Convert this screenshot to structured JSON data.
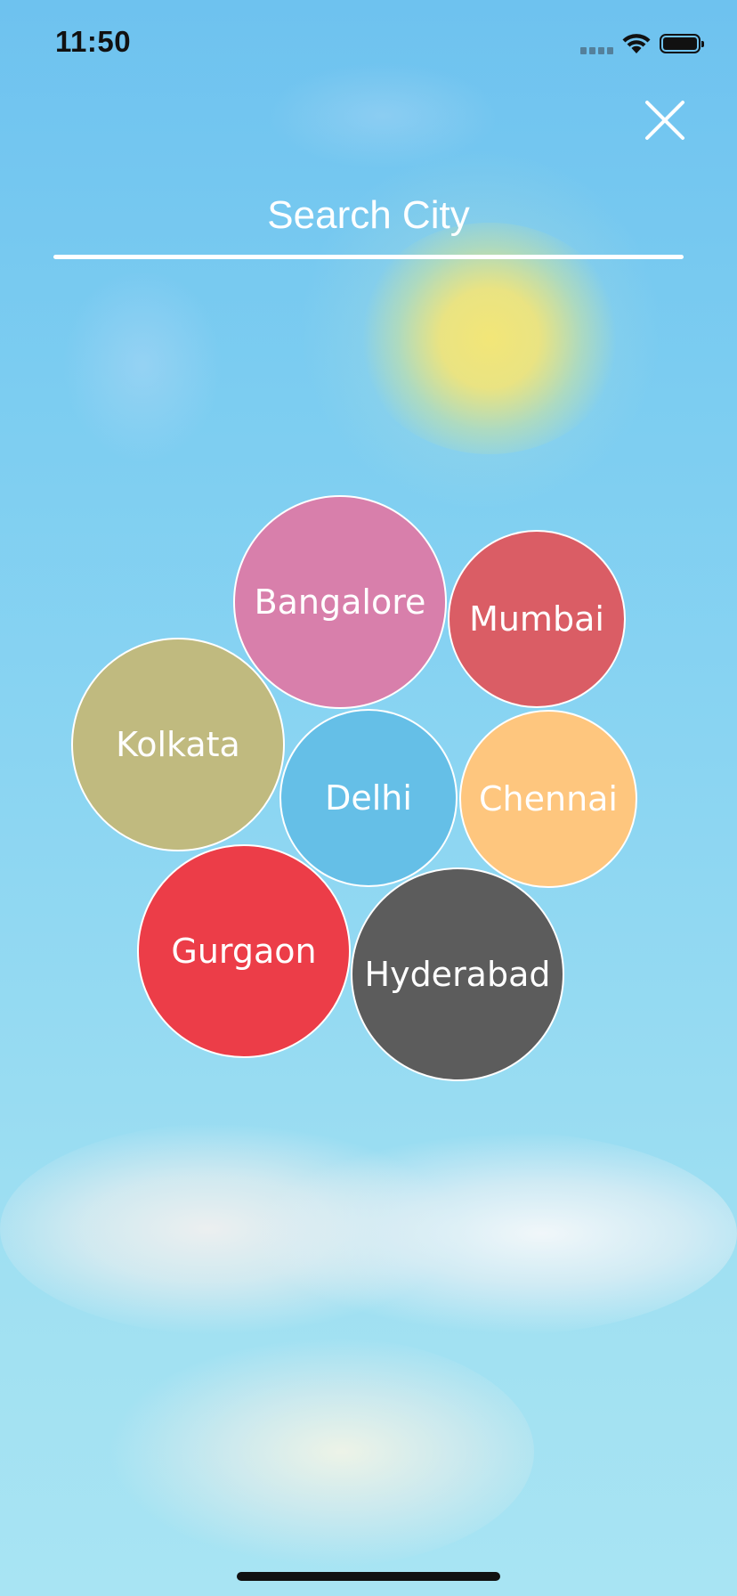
{
  "status_bar": {
    "time": "11:50"
  },
  "search": {
    "placeholder": "Search City",
    "value": ""
  },
  "close_button": {
    "icon": "close-icon"
  },
  "cities": [
    {
      "name": "Bangalore",
      "color": "#d87fab"
    },
    {
      "name": "Mumbai",
      "color": "#da5d65"
    },
    {
      "name": "Kolkata",
      "color": "#c0ba7f"
    },
    {
      "name": "Delhi",
      "color": "#65bfe7"
    },
    {
      "name": "Chennai",
      "color": "#fec67e"
    },
    {
      "name": "Gurgaon",
      "color": "#ec3d48"
    },
    {
      "name": "Hyderabad",
      "color": "#5c5c5c"
    }
  ]
}
